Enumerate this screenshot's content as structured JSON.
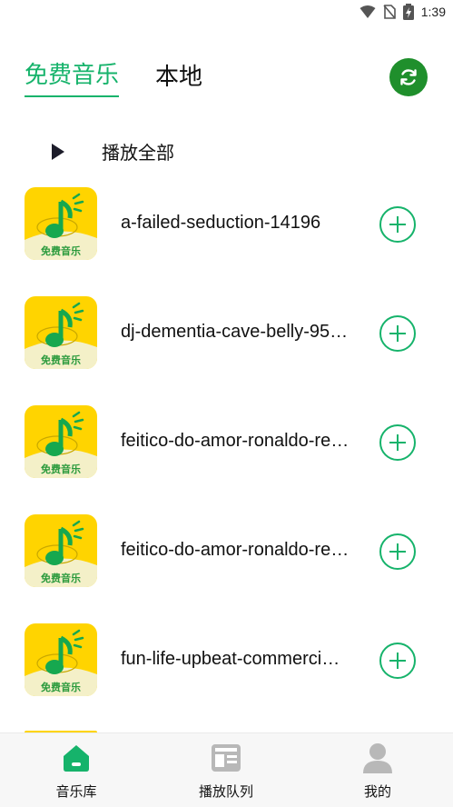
{
  "status": {
    "time": "1:39"
  },
  "tabs": [
    {
      "label": "免费音乐",
      "active": true
    },
    {
      "label": "本地",
      "active": false
    }
  ],
  "play_all": {
    "label": "播放全部"
  },
  "songs": [
    {
      "title": "a-failed-seduction-14196",
      "thumb_caption": "免费音乐"
    },
    {
      "title": "dj-dementia-cave-belly-95…",
      "thumb_caption": "免费音乐"
    },
    {
      "title": "feitico-do-amor-ronaldo-re…",
      "thumb_caption": "免费音乐"
    },
    {
      "title": "feitico-do-amor-ronaldo-re…",
      "thumb_caption": "免费音乐"
    },
    {
      "title": "fun-life-upbeat-commerci…",
      "thumb_caption": "免费音乐"
    }
  ],
  "nav": [
    {
      "label": "音乐库",
      "icon": "home-icon",
      "active": true
    },
    {
      "label": "播放队列",
      "icon": "queue-icon",
      "active": false
    },
    {
      "label": "我的",
      "icon": "user-icon",
      "active": false
    }
  ],
  "colors": {
    "accent": "#16b36b",
    "refresh": "#1f8f2c",
    "thumb_yellow": "#ffd400"
  }
}
